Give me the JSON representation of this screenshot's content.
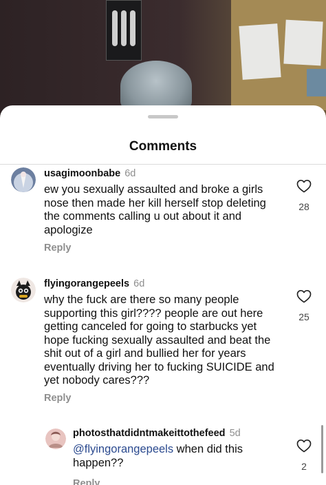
{
  "sheet": {
    "title": "Comments"
  },
  "comments": [
    {
      "username": "usagimoonbabe",
      "time": "6d",
      "text": "ew you sexually assaulted and broke a girls nose then made her kill herself stop deleting the comments calling u out about it and apologize",
      "reply_label": "Reply",
      "likes": "28"
    },
    {
      "username": "flyingorangepeels",
      "time": "6d",
      "text": "why the fuck are there so many people supporting this girl???? people are out here getting canceled for going to starbucks yet hope fucking sexually assaulted and beat the shit out of a girl and bullied her for years eventually driving her to fucking SUICIDE and yet nobody cares???",
      "reply_label": "Reply",
      "likes": "25"
    },
    {
      "username": "photosthatdidntmakeittothefeed",
      "time": "5d",
      "mention": "@flyingorangepeels",
      "text": " when did this happen??",
      "reply_label": "Reply",
      "likes": "2"
    }
  ],
  "icons": {
    "like": "heart-outline-icon"
  }
}
